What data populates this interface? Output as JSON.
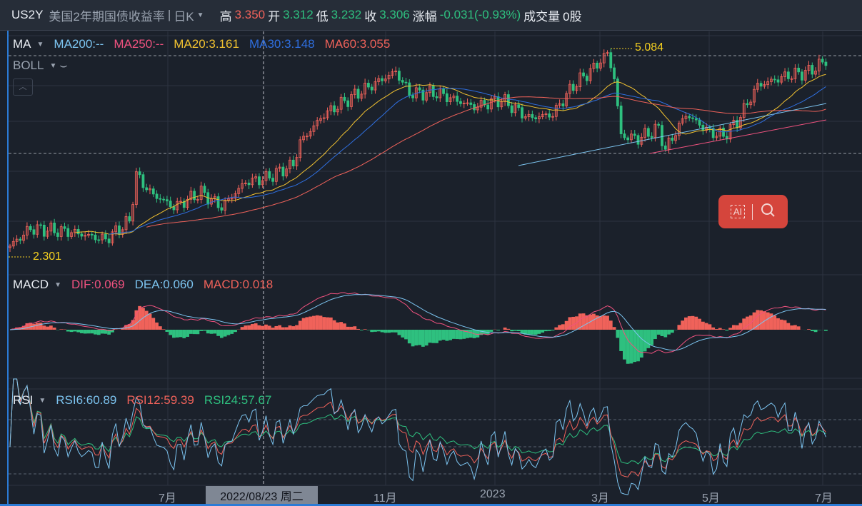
{
  "header": {
    "symbol": "US2Y",
    "name": "美国2年期国债收益率",
    "period": "日K",
    "high_label": "高",
    "high": "3.350",
    "open_label": "开",
    "open": "3.312",
    "low_label": "低",
    "low": "3.232",
    "close_label": "收",
    "close": "3.306",
    "change_label": "涨幅",
    "change": "-0.031(-0.93%)",
    "volume_label": "成交量",
    "volume": "0股"
  },
  "ma_legend": {
    "name": "MA",
    "ma200": "MA200:--",
    "ma250": "MA250:--",
    "ma20": "MA20:3.161",
    "ma30": "MA30:3.148",
    "ma60": "MA60:3.055"
  },
  "boll_legend": {
    "name": "BOLL"
  },
  "macd_legend": {
    "name": "MACD",
    "dif": "DIF:0.069",
    "dea": "DEA:0.060",
    "macd": "MACD:0.018"
  },
  "rsi_legend": {
    "name": "RSI",
    "rsi6": "RSI6:60.89",
    "rsi12": "RSI12:59.39",
    "rsi24": "RSI24:57.67"
  },
  "price_labels": {
    "max": "5.084",
    "min": "2.301"
  },
  "x_axis": {
    "labels": [
      "7月",
      "11月",
      "2023",
      "3月",
      "5月",
      "7月"
    ],
    "crosshair": "2022/08/23 周二"
  },
  "colors": {
    "up": "#f0625a",
    "down": "#2ec07f",
    "ma20": "#f2c230",
    "ma30": "#2f6fe0",
    "ma60": "#f0625a",
    "dif": "#f0527f",
    "dea": "#7cc4f0",
    "rsi6": "#7cc4f0",
    "rsi12": "#f0625a",
    "rsi24": "#2ec07f"
  },
  "chart_data": {
    "type": "candlestick",
    "bars": 240,
    "price_range": [
      2.301,
      5.084
    ],
    "close_keypoints": [
      [
        0,
        2.4
      ],
      [
        6,
        2.64
      ],
      [
        18,
        2.59
      ],
      [
        28,
        2.49
      ],
      [
        35,
        2.74
      ],
      [
        37,
        3.37
      ],
      [
        41,
        3.13
      ],
      [
        48,
        2.93
      ],
      [
        56,
        3.13
      ],
      [
        62,
        2.93
      ],
      [
        69,
        3.27
      ],
      [
        75,
        3.32
      ],
      [
        83,
        3.51
      ],
      [
        85,
        3.81
      ],
      [
        92,
        4.19
      ],
      [
        102,
        4.48
      ],
      [
        113,
        4.77
      ],
      [
        117,
        4.48
      ],
      [
        125,
        4.48
      ],
      [
        136,
        4.29
      ],
      [
        144,
        4.39
      ],
      [
        152,
        4.14
      ],
      [
        159,
        4.19
      ],
      [
        165,
        4.58
      ],
      [
        171,
        4.82
      ],
      [
        175,
        5.02
      ],
      [
        177,
        4.68
      ],
      [
        179,
        3.9
      ],
      [
        184,
        3.86
      ],
      [
        190,
        4.0
      ],
      [
        192,
        3.71
      ],
      [
        198,
        4.19
      ],
      [
        205,
        3.95
      ],
      [
        209,
        3.9
      ],
      [
        213,
        4.09
      ],
      [
        219,
        4.58
      ],
      [
        228,
        4.72
      ],
      [
        234,
        4.77
      ],
      [
        239,
        4.92
      ]
    ],
    "rsi_levels": [
      70,
      50,
      30
    ]
  }
}
